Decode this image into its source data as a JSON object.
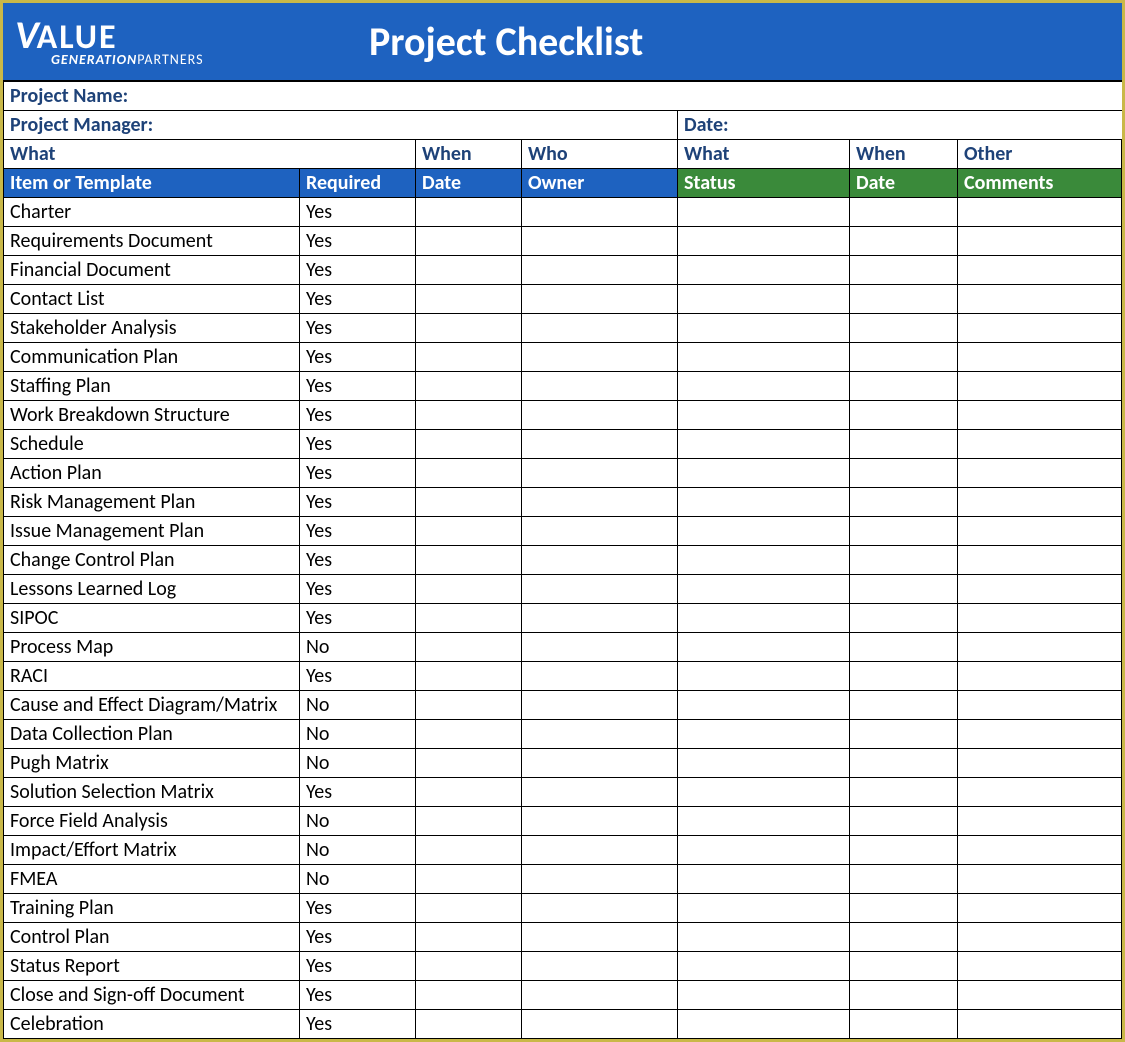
{
  "logo": {
    "v": "V",
    "alue": "ALUE",
    "gen": "GENERATION",
    "partners": "PARTNERS"
  },
  "title": "Project Checklist",
  "meta": {
    "project_name_label": "Project Name:",
    "project_manager_label": "Project Manager:",
    "date_label": "Date:"
  },
  "group_headers": {
    "what1": "What",
    "when1": "When",
    "who": "Who",
    "what2": "What",
    "when2": "When",
    "other": "Other"
  },
  "col_headers": {
    "item": "Item or Template",
    "required": "Required",
    "date1": "Date",
    "owner": "Owner",
    "status": "Status",
    "date2": "Date",
    "comments": "Comments"
  },
  "rows": [
    {
      "item": "Charter",
      "required": "Yes",
      "date1": "",
      "owner": "",
      "status": "",
      "date2": "",
      "comments": ""
    },
    {
      "item": "Requirements Document",
      "required": "Yes",
      "date1": "",
      "owner": "",
      "status": "",
      "date2": "",
      "comments": ""
    },
    {
      "item": "Financial Document",
      "required": "Yes",
      "date1": "",
      "owner": "",
      "status": "",
      "date2": "",
      "comments": ""
    },
    {
      "item": "Contact List",
      "required": "Yes",
      "date1": "",
      "owner": "",
      "status": "",
      "date2": "",
      "comments": ""
    },
    {
      "item": "Stakeholder Analysis",
      "required": "Yes",
      "date1": "",
      "owner": "",
      "status": "",
      "date2": "",
      "comments": ""
    },
    {
      "item": "Communication Plan",
      "required": "Yes",
      "date1": "",
      "owner": "",
      "status": "",
      "date2": "",
      "comments": ""
    },
    {
      "item": "Staffing Plan",
      "required": "Yes",
      "date1": "",
      "owner": "",
      "status": "",
      "date2": "",
      "comments": ""
    },
    {
      "item": "Work Breakdown Structure",
      "required": "Yes",
      "date1": "",
      "owner": "",
      "status": "",
      "date2": "",
      "comments": ""
    },
    {
      "item": "Schedule",
      "required": "Yes",
      "date1": "",
      "owner": "",
      "status": "",
      "date2": "",
      "comments": ""
    },
    {
      "item": "Action Plan",
      "required": "Yes",
      "date1": "",
      "owner": "",
      "status": "",
      "date2": "",
      "comments": ""
    },
    {
      "item": "Risk Management Plan",
      "required": "Yes",
      "date1": "",
      "owner": "",
      "status": "",
      "date2": "",
      "comments": ""
    },
    {
      "item": "Issue Management Plan",
      "required": "Yes",
      "date1": "",
      "owner": "",
      "status": "",
      "date2": "",
      "comments": ""
    },
    {
      "item": "Change Control Plan",
      "required": "Yes",
      "date1": "",
      "owner": "",
      "status": "",
      "date2": "",
      "comments": ""
    },
    {
      "item": "Lessons Learned Log",
      "required": "Yes",
      "date1": "",
      "owner": "",
      "status": "",
      "date2": "",
      "comments": ""
    },
    {
      "item": "SIPOC",
      "required": "Yes",
      "date1": "",
      "owner": "",
      "status": "",
      "date2": "",
      "comments": ""
    },
    {
      "item": "Process Map",
      "required": "No",
      "date1": "",
      "owner": "",
      "status": "",
      "date2": "",
      "comments": ""
    },
    {
      "item": "RACI",
      "required": "Yes",
      "date1": "",
      "owner": "",
      "status": "",
      "date2": "",
      "comments": ""
    },
    {
      "item": "Cause and Effect Diagram/Matrix",
      "required": "No",
      "date1": "",
      "owner": "",
      "status": "",
      "date2": "",
      "comments": ""
    },
    {
      "item": "Data Collection Plan",
      "required": "No",
      "date1": "",
      "owner": "",
      "status": "",
      "date2": "",
      "comments": ""
    },
    {
      "item": "Pugh Matrix",
      "required": "No",
      "date1": "",
      "owner": "",
      "status": "",
      "date2": "",
      "comments": ""
    },
    {
      "item": "Solution Selection Matrix",
      "required": "Yes",
      "date1": "",
      "owner": "",
      "status": "",
      "date2": "",
      "comments": ""
    },
    {
      "item": "Force Field Analysis",
      "required": "No",
      "date1": "",
      "owner": "",
      "status": "",
      "date2": "",
      "comments": ""
    },
    {
      "item": "Impact/Effort Matrix",
      "required": "No",
      "date1": "",
      "owner": "",
      "status": "",
      "date2": "",
      "comments": ""
    },
    {
      "item": "FMEA",
      "required": "No",
      "date1": "",
      "owner": "",
      "status": "",
      "date2": "",
      "comments": ""
    },
    {
      "item": "Training Plan",
      "required": "Yes",
      "date1": "",
      "owner": "",
      "status": "",
      "date2": "",
      "comments": ""
    },
    {
      "item": "Control Plan",
      "required": "Yes",
      "date1": "",
      "owner": "",
      "status": "",
      "date2": "",
      "comments": ""
    },
    {
      "item": "Status Report",
      "required": "Yes",
      "date1": "",
      "owner": "",
      "status": "",
      "date2": "",
      "comments": ""
    },
    {
      "item": "Close and Sign-off Document",
      "required": "Yes",
      "date1": "",
      "owner": "",
      "status": "",
      "date2": "",
      "comments": ""
    },
    {
      "item": "Celebration",
      "required": "Yes",
      "date1": "",
      "owner": "",
      "status": "",
      "date2": "",
      "comments": ""
    }
  ]
}
